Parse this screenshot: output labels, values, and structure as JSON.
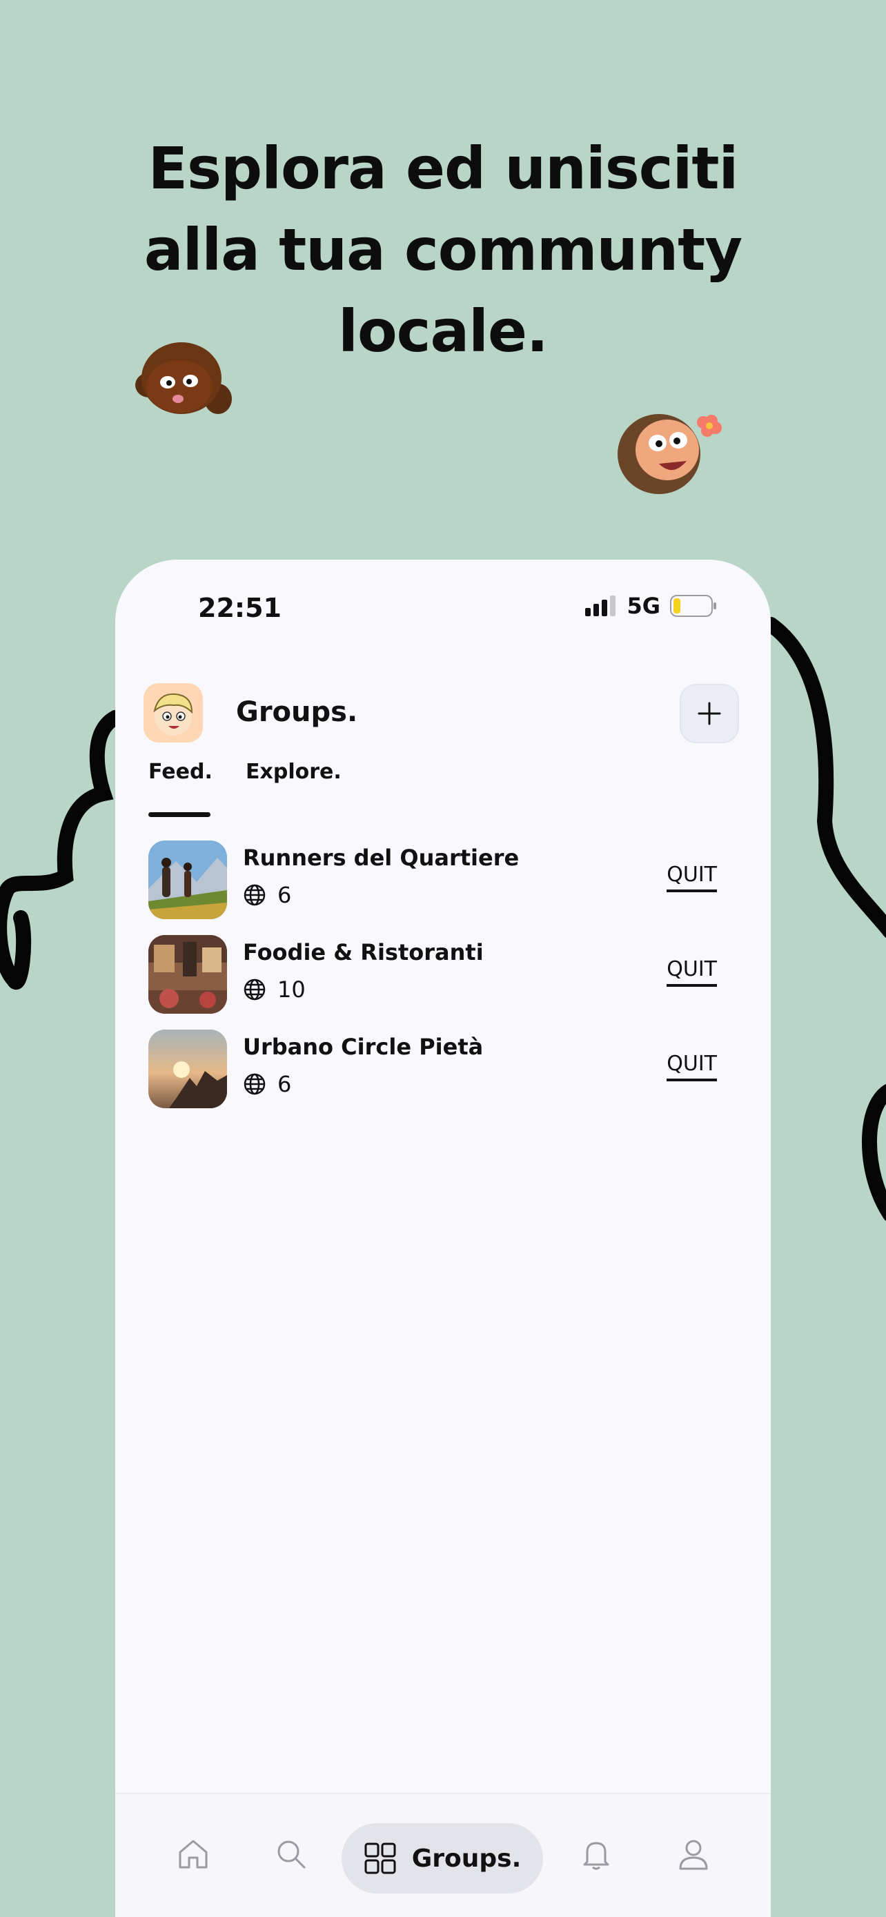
{
  "headline": [
    "Esplora ed unisciti",
    "alla tua communty",
    "locale."
  ],
  "status": {
    "time": "22:51",
    "network": "5G"
  },
  "header": {
    "title": "Groups.",
    "add_icon": "plus-icon"
  },
  "tabs": [
    {
      "label": "Feed.",
      "active": true
    },
    {
      "label": "Explore.",
      "active": false
    }
  ],
  "groups": [
    {
      "name": "Runners del Quartiere",
      "members": "6",
      "action": "QUIT"
    },
    {
      "name": "Foodie & Ristoranti",
      "members": "10",
      "action": "QUIT"
    },
    {
      "name": "Urbano Circle Pietà",
      "members": "6",
      "action": "QUIT"
    }
  ],
  "nav": {
    "items": [
      "home-icon",
      "search-icon",
      "groups-icon",
      "bell-icon",
      "user-icon"
    ],
    "active_label": "Groups."
  },
  "colors": {
    "background": "#b8d5c8",
    "phone": "#f8f8fd",
    "accent": "#111111"
  }
}
